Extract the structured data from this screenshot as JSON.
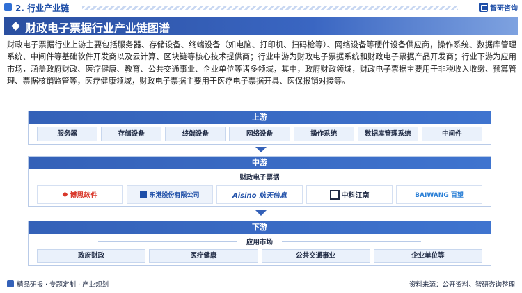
{
  "header": {
    "section_title": "2. 行业产业链",
    "brand": "智研咨询",
    "brand_icon": "grid-logo-icon"
  },
  "banner": {
    "title": "财政电子票据行业产业链图谱"
  },
  "intro": "财政电子票据行业上游主要包括服务器、存储设备、终端设备（如电脑、打印机、扫码枪等）、网络设备等硬件设备供应商，操作系统、数据库管理系统、中间件等基础软件开发商以及云计算、区块链等核心技术提供商；行业中游为财政电子票据系统和财政电子票据产品开发商；行业下游为应用市场，涵盖政府财政、医疗健康、教育、公共交通事业、企业单位等诸多领域，其中，政府财政领域，财政电子票据主要用于非税收入收缴、预算管理、票据核销监管等，医疗健康领域，财政电子票据主要用于医疗电子票据开具、医保报销对接等。",
  "upstream": {
    "title": "上游",
    "items": [
      "服务器",
      "存储设备",
      "终端设备",
      "网络设备",
      "操作系统",
      "数据库管理系统",
      "中间件"
    ]
  },
  "midstream": {
    "title": "中游",
    "subtitle": "财政电子票据",
    "companies": [
      {
        "name": "博思软件",
        "color": "#d9382b"
      },
      {
        "name": "东港股份有限公司",
        "color": "#1f4fa8"
      },
      {
        "name": "Aisino 航天信息",
        "color": "#1f4fa8"
      },
      {
        "name": "中科江南",
        "color": "#1f2a44"
      },
      {
        "name": "BAIWANG 百望",
        "color": "#2a7fd6"
      }
    ]
  },
  "downstream": {
    "title": "下游",
    "subtitle": "应用市场",
    "items": [
      "政府财政",
      "医疗健康",
      "公共交通事业",
      "企业单位等"
    ]
  },
  "footer": {
    "left": "精品研报 · 专题定制 · 产业规划",
    "right": "资料来源：公开资料、智研咨询整理"
  }
}
